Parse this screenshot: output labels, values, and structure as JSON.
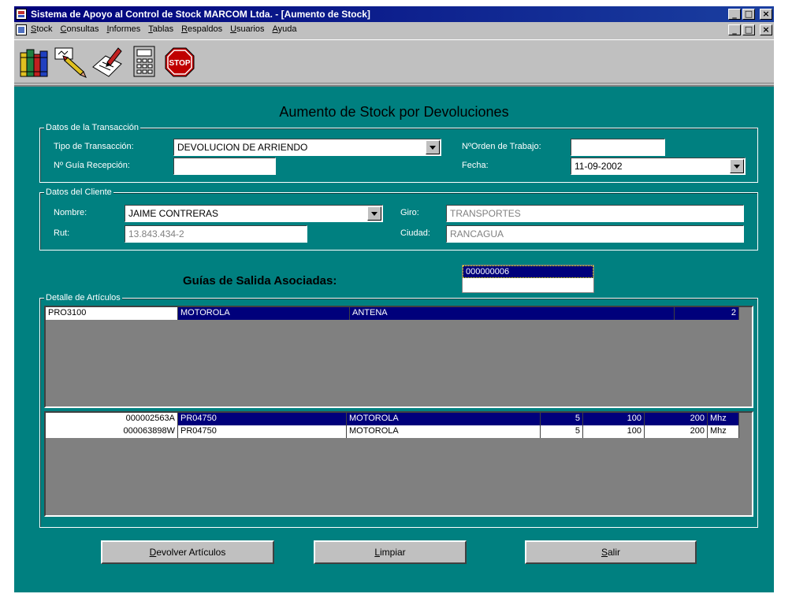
{
  "window": {
    "title": "Sistema de Apoyo al Control de Stock MARCOM Ltda. - [Aumento de Stock]",
    "min_glyph": "_",
    "max_glyph": "□",
    "close_glyph": "×"
  },
  "menu": {
    "items": [
      {
        "accel": "S",
        "rest": "tock"
      },
      {
        "accel": "C",
        "rest": "onsultas"
      },
      {
        "accel": "I",
        "rest": "nformes"
      },
      {
        "accel": "T",
        "rest": "ablas"
      },
      {
        "accel": "R",
        "rest": "espaldos"
      },
      {
        "accel": "U",
        "rest": "suarios"
      },
      {
        "accel": "A",
        "rest": "yuda"
      }
    ]
  },
  "toolbar": {
    "buttons": [
      "books-icon",
      "pencil-icon",
      "document-edit-icon",
      "calculator-icon",
      "stop-icon"
    ],
    "stop_text": "STOP"
  },
  "form": {
    "title": "Aumento de Stock por Devoluciones",
    "transaction": {
      "legend": "Datos de la Transacción",
      "tipo_label": "Tipo de Transacción:",
      "tipo_value": "DEVOLUCION DE ARRIENDO",
      "guia_label": "Nº Guía Recepción:",
      "guia_value": "",
      "orden_label": "NºOrden de Trabajo:",
      "orden_value": "",
      "fecha_label": "Fecha:",
      "fecha_value": "11-09-2002"
    },
    "client": {
      "legend": "Datos del Cliente",
      "nombre_label": "Nombre:",
      "nombre_value": "JAIME CONTRERAS",
      "rut_label": "Rut:",
      "rut_value": "13.843.434-2",
      "giro_label": "Giro:",
      "giro_value": "TRANSPORTES",
      "ciudad_label": "Ciudad:",
      "ciudad_value": "RANCAGUA"
    },
    "guias": {
      "label": "Guías de Salida Asociadas:",
      "items": [
        "000000006"
      ]
    },
    "detail": {
      "legend": "Detalle de Artículos",
      "grid1_rows": [
        {
          "codigo": "PRO3100",
          "marca": "MOTOROLA",
          "descripcion": "ANTENA",
          "extra": "",
          "cantidad": "2"
        }
      ],
      "grid2_rows": [
        {
          "serie": "000002563A",
          "codigo": "PR04750",
          "marca": "MOTOROLA",
          "c1": "5",
          "c2": "100",
          "c3": "200",
          "unidad": "Mhz"
        },
        {
          "serie": "000063898W",
          "codigo": "PR04750",
          "marca": "MOTOROLA",
          "c1": "5",
          "c2": "100",
          "c3": "200",
          "unidad": "Mhz"
        }
      ]
    },
    "buttons": {
      "devolver": {
        "accel": "D",
        "rest": "evolver Artículos"
      },
      "limpiar": {
        "accel": "L",
        "rest": "impiar"
      },
      "salir": {
        "accel": "S",
        "rest": "alir"
      }
    }
  }
}
